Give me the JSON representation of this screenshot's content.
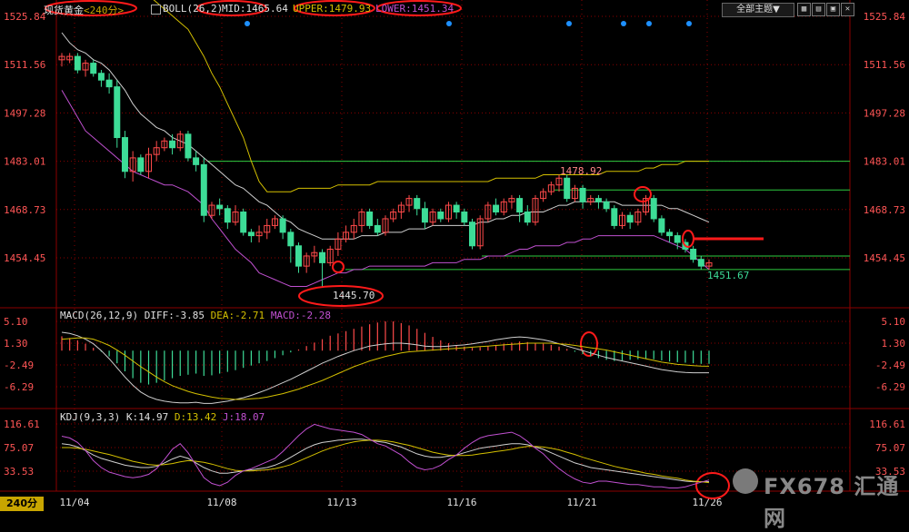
{
  "header": {
    "symbol": "现货黄金",
    "period_tag": "<240分>",
    "indicator": "BOLL(26,2)",
    "mid": "MID:1465.64",
    "upper": "UPPER:1479.93",
    "lower": "LOWER:1451.34"
  },
  "toolbar": {
    "theme_button": "全部主题▼",
    "icons": [
      "grid-icon",
      "layout-icon",
      "settings-icon",
      "close-icon"
    ]
  },
  "macd_header": {
    "label": "MACD(26,12,9)",
    "diff": "DIFF:-3.85",
    "dea": "DEA:-2.71",
    "macd": "MACD:-2.28"
  },
  "kdj_header": {
    "label": "KDJ(9,3,3)",
    "k": "K:14.97",
    "d": "D:13.42",
    "j": "J:18.07"
  },
  "period_button": "240分",
  "watermark": "FX678 汇通网",
  "colors": {
    "up": "#ff4a4a",
    "down": "#3ddc97",
    "mid": "#cfcfcf",
    "upper": "#d4c000",
    "lower": "#c050d0",
    "axis": "#ff5555",
    "grid": "#8b0000",
    "hline": "#2ecc40",
    "annot": "#ff1a1a"
  },
  "chart_data": {
    "type": "candlestick",
    "x_labels": [
      "11/04",
      "11/08",
      "11/13",
      "11/16",
      "11/21",
      "11/26"
    ],
    "price_axis": [
      1525.84,
      1511.56,
      1497.28,
      1483.01,
      1468.73,
      1454.45
    ],
    "macd_axis": [
      5.1,
      1.3,
      -2.49,
      -6.29
    ],
    "kdj_axis": [
      116.61,
      75.07,
      33.53
    ],
    "annotations": {
      "high_label": "1478.92",
      "low_label": "1445.70",
      "last_low_label": "1451.67"
    },
    "horizontal_levels": [
      1483.0,
      1474.5,
      1455.0,
      1451.0
    ],
    "candles": [
      [
        1513,
        1514,
        1511,
        1515
      ],
      [
        1513,
        1514,
        1512,
        1515
      ],
      [
        1514,
        1510,
        1509,
        1515
      ],
      [
        1510,
        1512,
        1508,
        1513
      ],
      [
        1512,
        1509,
        1508,
        1513
      ],
      [
        1509,
        1507,
        1505,
        1510
      ],
      [
        1507,
        1505,
        1503,
        1509
      ],
      [
        1505,
        1490,
        1487,
        1507
      ],
      [
        1490,
        1480,
        1478,
        1492
      ],
      [
        1480,
        1484,
        1477,
        1486
      ],
      [
        1484,
        1480,
        1479,
        1485
      ],
      [
        1480,
        1485,
        1478,
        1487
      ],
      [
        1485,
        1487,
        1483,
        1489
      ],
      [
        1487,
        1489,
        1486,
        1490
      ],
      [
        1489,
        1487,
        1485,
        1491
      ],
      [
        1487,
        1491,
        1486,
        1492
      ],
      [
        1491,
        1484,
        1483,
        1492
      ],
      [
        1484,
        1482,
        1480,
        1486
      ],
      [
        1482,
        1467,
        1465,
        1484
      ],
      [
        1467,
        1470,
        1466,
        1471
      ],
      [
        1470,
        1469,
        1467,
        1472
      ],
      [
        1469,
        1465,
        1463,
        1470
      ],
      [
        1465,
        1468,
        1464,
        1470
      ],
      [
        1468,
        1462,
        1461,
        1469
      ],
      [
        1462,
        1461,
        1459,
        1463
      ],
      [
        1461,
        1462,
        1459,
        1464
      ],
      [
        1462,
        1464,
        1460,
        1466
      ],
      [
        1464,
        1466,
        1463,
        1467
      ],
      [
        1466,
        1462,
        1460,
        1467
      ],
      [
        1462,
        1458,
        1453,
        1463
      ],
      [
        1458,
        1452,
        1450,
        1459
      ],
      [
        1452,
        1455,
        1450,
        1456
      ],
      [
        1455,
        1456,
        1453,
        1458
      ],
      [
        1456,
        1453,
        1446,
        1457
      ],
      [
        1453,
        1457,
        1452,
        1458
      ],
      [
        1457,
        1460,
        1455,
        1462
      ],
      [
        1460,
        1462,
        1459,
        1464
      ],
      [
        1462,
        1464,
        1460,
        1466
      ],
      [
        1464,
        1468,
        1462,
        1469
      ],
      [
        1468,
        1464,
        1463,
        1469
      ],
      [
        1464,
        1462,
        1461,
        1466
      ],
      [
        1462,
        1466,
        1461,
        1467
      ],
      [
        1466,
        1468,
        1465,
        1469
      ],
      [
        1468,
        1470,
        1466,
        1471
      ],
      [
        1470,
        1472,
        1468,
        1473
      ],
      [
        1472,
        1469,
        1467,
        1473
      ],
      [
        1469,
        1465,
        1463,
        1471
      ],
      [
        1465,
        1468,
        1464,
        1469
      ],
      [
        1468,
        1466,
        1465,
        1469
      ],
      [
        1466,
        1470,
        1465,
        1471
      ],
      [
        1470,
        1468,
        1466,
        1471
      ],
      [
        1468,
        1465,
        1464,
        1469
      ],
      [
        1465,
        1458,
        1457,
        1466
      ],
      [
        1458,
        1466,
        1457,
        1467
      ],
      [
        1466,
        1470,
        1465,
        1471
      ],
      [
        1470,
        1468,
        1467,
        1472
      ],
      [
        1468,
        1471,
        1467,
        1472
      ],
      [
        1471,
        1472,
        1469,
        1473
      ],
      [
        1472,
        1468,
        1465,
        1473
      ],
      [
        1468,
        1465,
        1464,
        1470
      ],
      [
        1465,
        1472,
        1464,
        1473
      ],
      [
        1472,
        1474,
        1471,
        1475
      ],
      [
        1474,
        1476,
        1473,
        1477
      ],
      [
        1476,
        1478,
        1474,
        1479
      ],
      [
        1478,
        1472,
        1471,
        1479
      ],
      [
        1472,
        1475,
        1471,
        1476
      ],
      [
        1475,
        1471,
        1469,
        1476
      ],
      [
        1471,
        1472,
        1470,
        1473
      ],
      [
        1472,
        1471,
        1469,
        1473
      ],
      [
        1471,
        1469,
        1468,
        1472
      ],
      [
        1469,
        1464,
        1463,
        1470
      ],
      [
        1464,
        1467,
        1463,
        1468
      ],
      [
        1467,
        1465,
        1463,
        1468
      ],
      [
        1465,
        1468,
        1464,
        1469
      ],
      [
        1468,
        1472,
        1467,
        1473
      ],
      [
        1472,
        1466,
        1465,
        1473
      ],
      [
        1466,
        1462,
        1461,
        1467
      ],
      [
        1462,
        1461,
        1459,
        1463
      ],
      [
        1461,
        1459,
        1457,
        1462
      ],
      [
        1459,
        1457,
        1456,
        1460
      ],
      [
        1457,
        1454,
        1453,
        1458
      ],
      [
        1454,
        1452,
        1451,
        1455
      ],
      [
        1452,
        1453,
        1451,
        1454
      ]
    ],
    "boll": {
      "mid": [
        1521,
        1518,
        1516,
        1515,
        1513,
        1512,
        1510,
        1507,
        1504,
        1500,
        1497,
        1495,
        1493,
        1492,
        1490,
        1489,
        1488,
        1486,
        1484,
        1482,
        1480,
        1478,
        1476,
        1475,
        1473,
        1471,
        1470,
        1468,
        1466,
        1465,
        1463,
        1462,
        1461,
        1460,
        1460,
        1460,
        1460,
        1460,
        1461,
        1461,
        1461,
        1462,
        1462,
        1462,
        1463,
        1463,
        1463,
        1464,
        1464,
        1464,
        1464,
        1464,
        1464,
        1465,
        1465,
        1466,
        1466,
        1467,
        1467,
        1468,
        1468,
        1468,
        1469,
        1470,
        1470,
        1471,
        1471,
        1471,
        1471,
        1471,
        1471,
        1470,
        1470,
        1470,
        1470,
        1470,
        1470,
        1469,
        1469,
        1468,
        1467,
        1466,
        1465
      ],
      "upper": [
        1536,
        1537,
        1537,
        1537,
        1536,
        1536,
        1536,
        1536,
        1535,
        1534,
        1533,
        1532,
        1530,
        1528,
        1526,
        1524,
        1522,
        1518,
        1514,
        1509,
        1505,
        1500,
        1495,
        1490,
        1483,
        1477,
        1474,
        1474,
        1474,
        1474,
        1475,
        1475,
        1475,
        1475,
        1475,
        1476,
        1476,
        1476,
        1476,
        1476,
        1477,
        1477,
        1477,
        1477,
        1477,
        1477,
        1477,
        1477,
        1477,
        1477,
        1477,
        1477,
        1477,
        1477,
        1477,
        1478,
        1478,
        1478,
        1478,
        1478,
        1478,
        1479,
        1479,
        1479,
        1479,
        1479,
        1479,
        1479,
        1479,
        1480,
        1480,
        1480,
        1480,
        1480,
        1481,
        1481,
        1482,
        1482,
        1482,
        1483,
        1483,
        1483,
        1483
      ],
      "lower": [
        1504,
        1500,
        1496,
        1492,
        1490,
        1488,
        1486,
        1484,
        1482,
        1480,
        1479,
        1478,
        1477,
        1476,
        1476,
        1475,
        1474,
        1472,
        1470,
        1466,
        1463,
        1460,
        1457,
        1455,
        1453,
        1450,
        1449,
        1448,
        1447,
        1446,
        1446,
        1446,
        1447,
        1448,
        1449,
        1450,
        1450,
        1451,
        1451,
        1452,
        1452,
        1452,
        1452,
        1452,
        1452,
        1452,
        1452,
        1453,
        1453,
        1453,
        1453,
        1454,
        1454,
        1454,
        1455,
        1455,
        1455,
        1456,
        1457,
        1457,
        1458,
        1458,
        1458,
        1458,
        1459,
        1459,
        1460,
        1460,
        1461,
        1461,
        1461,
        1461,
        1461,
        1461,
        1461,
        1461,
        1460,
        1459,
        1458,
        1457,
        1455,
        1453,
        1451
      ]
    },
    "macd": {
      "hist": [
        2.5,
        2.2,
        1.8,
        1.2,
        0.5,
        -0.2,
        -1.0,
        -2.2,
        -3.6,
        -4.8,
        -5.6,
        -5.9,
        -5.6,
        -5.2,
        -4.8,
        -4.4,
        -4.2,
        -4.0,
        -4.4,
        -4.3,
        -4.0,
        -3.7,
        -3.4,
        -3.0,
        -2.6,
        -2.2,
        -1.8,
        -1.3,
        -0.8,
        -0.3,
        0.2,
        0.8,
        1.4,
        2.0,
        2.6,
        3.0,
        3.4,
        3.8,
        4.2,
        4.6,
        4.9,
        5.1,
        5.1,
        4.8,
        4.4,
        3.8,
        3.1,
        2.4,
        1.8,
        1.3,
        0.9,
        0.7,
        0.5,
        0.6,
        0.8,
        1.0,
        1.2,
        1.4,
        1.6,
        1.5,
        1.3,
        1.2,
        1.0,
        0.7,
        0.3,
        -0.2,
        -0.6,
        -1.0,
        -1.3,
        -1.6,
        -1.8,
        -1.7,
        -1.6,
        -1.5,
        -1.4,
        -1.5,
        -1.7,
        -1.9,
        -2.0,
        -2.1,
        -2.2,
        -2.3,
        -2.3
      ],
      "diff": [
        3.2,
        3.0,
        2.6,
        2.0,
        1.2,
        0.0,
        -1.4,
        -3.0,
        -4.6,
        -6.0,
        -7.2,
        -8.0,
        -8.5,
        -8.8,
        -9.0,
        -9.1,
        -9.1,
        -9.0,
        -9.2,
        -9.2,
        -9.0,
        -8.8,
        -8.5,
        -8.2,
        -7.8,
        -7.3,
        -6.8,
        -6.2,
        -5.6,
        -5.0,
        -4.3,
        -3.6,
        -2.9,
        -2.2,
        -1.6,
        -1.0,
        -0.5,
        0.0,
        0.4,
        0.8,
        1.0,
        1.2,
        1.3,
        1.3,
        1.2,
        1.0,
        0.8,
        0.7,
        0.7,
        0.8,
        0.9,
        1.0,
        1.2,
        1.4,
        1.6,
        1.9,
        2.1,
        2.3,
        2.4,
        2.3,
        2.1,
        1.9,
        1.6,
        1.2,
        0.8,
        0.4,
        0.0,
        -0.4,
        -0.8,
        -1.2,
        -1.5,
        -1.8,
        -2.1,
        -2.4,
        -2.7,
        -3.0,
        -3.3,
        -3.5,
        -3.7,
        -3.8,
        -3.85,
        -3.85,
        -3.85
      ],
      "dea": [
        2.0,
        2.1,
        2.2,
        2.2,
        2.0,
        1.5,
        0.9,
        0.1,
        -0.8,
        -1.8,
        -2.8,
        -3.7,
        -4.6,
        -5.4,
        -6.1,
        -6.6,
        -7.1,
        -7.5,
        -7.8,
        -8.1,
        -8.3,
        -8.4,
        -8.5,
        -8.5,
        -8.4,
        -8.3,
        -8.1,
        -7.8,
        -7.5,
        -7.1,
        -6.7,
        -6.2,
        -5.7,
        -5.2,
        -4.6,
        -4.0,
        -3.4,
        -2.8,
        -2.3,
        -1.8,
        -1.4,
        -1.0,
        -0.7,
        -0.4,
        -0.2,
        -0.1,
        0.0,
        0.1,
        0.2,
        0.3,
        0.4,
        0.5,
        0.6,
        0.7,
        0.8,
        0.9,
        1.0,
        1.1,
        1.2,
        1.3,
        1.3,
        1.3,
        1.3,
        1.2,
        1.1,
        0.9,
        0.7,
        0.5,
        0.3,
        0.1,
        -0.2,
        -0.5,
        -0.8,
        -1.1,
        -1.4,
        -1.7,
        -2.0,
        -2.2,
        -2.4,
        -2.5,
        -2.6,
        -2.7,
        -2.71
      ]
    },
    "kdj": {
      "k": [
        82,
        80,
        76,
        70,
        62,
        56,
        52,
        48,
        44,
        42,
        40,
        40,
        42,
        48,
        55,
        60,
        56,
        48,
        40,
        34,
        30,
        30,
        32,
        34,
        36,
        38,
        40,
        44,
        50,
        58,
        66,
        74,
        80,
        84,
        86,
        88,
        89,
        90,
        90,
        88,
        86,
        84,
        80,
        76,
        70,
        64,
        60,
        58,
        58,
        60,
        62,
        66,
        70,
        74,
        76,
        78,
        80,
        82,
        82,
        80,
        76,
        72,
        66,
        60,
        54,
        48,
        44,
        40,
        38,
        36,
        34,
        32,
        30,
        28,
        26,
        24,
        22,
        20,
        18,
        16,
        15,
        15,
        14.97
      ],
      "d": [
        75,
        75,
        74,
        72,
        69,
        66,
        63,
        59,
        55,
        51,
        48,
        45,
        44,
        45,
        47,
        50,
        52,
        51,
        49,
        46,
        42,
        38,
        35,
        34,
        34,
        35,
        36,
        38,
        41,
        45,
        51,
        57,
        63,
        69,
        74,
        78,
        82,
        85,
        87,
        88,
        88,
        87,
        85,
        82,
        79,
        75,
        71,
        67,
        64,
        62,
        61,
        61,
        62,
        64,
        66,
        68,
        70,
        72,
        75,
        77,
        77,
        76,
        74,
        71,
        67,
        63,
        58,
        54,
        50,
        46,
        42,
        39,
        36,
        33,
        30,
        28,
        25,
        23,
        21,
        18,
        16,
        15,
        13.42
      ],
      "j": [
        95,
        92,
        84,
        70,
        52,
        40,
        32,
        28,
        24,
        22,
        24,
        28,
        38,
        54,
        72,
        82,
        66,
        44,
        22,
        12,
        8,
        14,
        26,
        34,
        38,
        44,
        50,
        56,
        68,
        82,
        96,
        108,
        116,
        112,
        108,
        106,
        104,
        102,
        98,
        90,
        82,
        78,
        70,
        62,
        50,
        40,
        36,
        38,
        44,
        54,
        62,
        74,
        84,
        92,
        96,
        98,
        100,
        102,
        96,
        86,
        74,
        64,
        50,
        38,
        28,
        20,
        14,
        12,
        16,
        16,
        14,
        12,
        10,
        10,
        8,
        6,
        6,
        4,
        4,
        6,
        10,
        14,
        18.07
      ]
    }
  }
}
